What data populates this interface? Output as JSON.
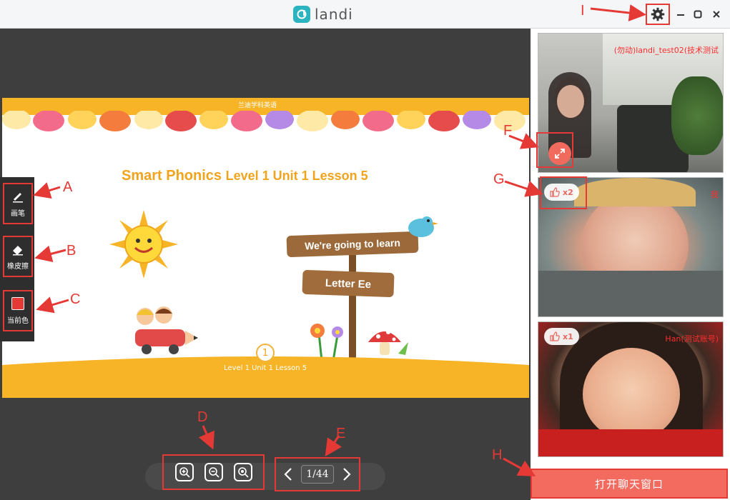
{
  "app": {
    "title": "landi"
  },
  "tools": {
    "pen": "画笔",
    "eraser": "橡皮擦",
    "color": "当前色"
  },
  "slide": {
    "brand": "兰迪学科英语",
    "title_main": "Smart Phonics",
    "title_sub": "Level 1 Unit 1 Lesson 5",
    "sign_top": "We're going to learn",
    "sign_bottom": "Letter Ee",
    "page_badge": "1",
    "footer": "Level 1 Unit 1 Lesson 5"
  },
  "pager": {
    "current": "1/44"
  },
  "videos": [
    {
      "name": "(勿动)landi_test02(技术测试",
      "likes": ""
    },
    {
      "name": "我",
      "likes": "x2"
    },
    {
      "name": "Han(测试账号)",
      "likes": "x1"
    }
  ],
  "chat_button": "打开聊天窗口",
  "annotations": {
    "A": "A",
    "B": "B",
    "C": "C",
    "D": "D",
    "E": "E",
    "F": "F",
    "G": "G",
    "H": "H",
    "I": "I"
  },
  "colors": {
    "accent": "#e53935",
    "brand": "#2bb3c0",
    "chat": "#f36a5f",
    "current_color": "#e53935"
  }
}
